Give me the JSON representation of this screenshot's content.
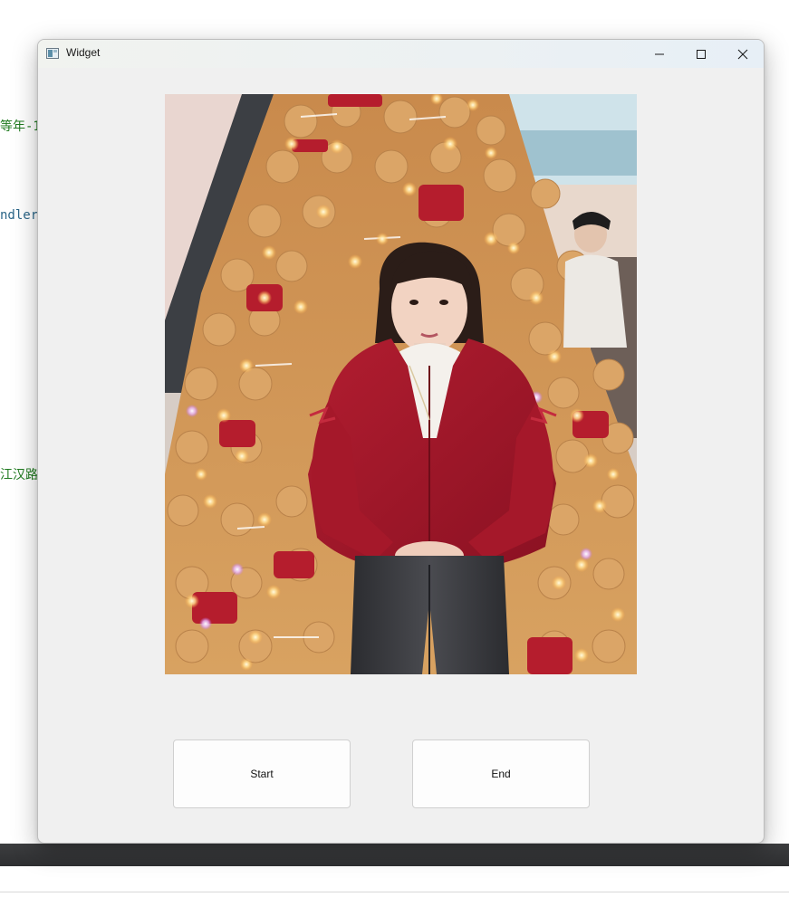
{
  "background": {
    "code_fragments": [
      "等年-1",
      "ndler",
      "江汉路"
    ]
  },
  "window": {
    "title": "Widget",
    "controls": {
      "minimize": "minimize-icon",
      "maximize": "maximize-icon",
      "close": "close-icon"
    }
  },
  "buttons": {
    "start_label": "Start",
    "end_label": "End"
  },
  "colors": {
    "window_bg": "#f0f0f0",
    "button_bg": "#fdfdfd",
    "coat_red": "#9e1628",
    "bear_tan": "#d39a5a"
  }
}
